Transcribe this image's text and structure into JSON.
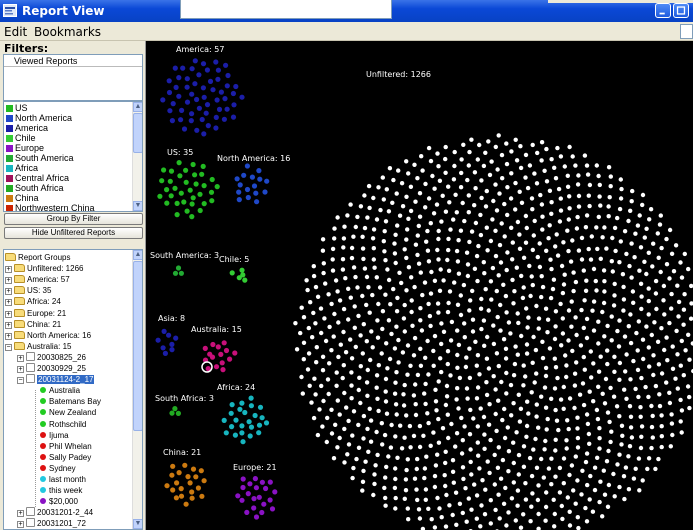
{
  "window": {
    "title": "Report View"
  },
  "menu": {
    "items": [
      "Edit",
      "Bookmarks"
    ]
  },
  "filters": {
    "heading": "Filters:",
    "viewed_reports_header": "Viewed Reports",
    "legend": [
      {
        "label": "US",
        "color": "#22bb22"
      },
      {
        "label": "North America",
        "color": "#1f48c8"
      },
      {
        "label": "America",
        "color": "#1b1ea8"
      },
      {
        "label": "Chile",
        "color": "#33cc33"
      },
      {
        "label": "Europe",
        "color": "#8a12c4"
      },
      {
        "label": "South America",
        "color": "#22aa33"
      },
      {
        "label": "Africa",
        "color": "#17b5bf"
      },
      {
        "label": "Central Africa",
        "color": "#a0105a"
      },
      {
        "label": "South Africa",
        "color": "#22aa22"
      },
      {
        "label": "China",
        "color": "#cc7a10"
      },
      {
        "label": "Northwestern China",
        "color": "#cc2200"
      }
    ],
    "buttons": {
      "group_by": "Group By Filter",
      "hide_unfiltered": "Hide Unfiltered Reports"
    }
  },
  "tree": {
    "root": "Report Groups",
    "groups": [
      "Unfiltered: 1266",
      "America: 57",
      "US: 35",
      "Africa: 24",
      "Europe: 21",
      "China: 21",
      "North America: 16",
      "Australia: 15"
    ],
    "australia_children": [
      "20030825_26",
      "20030929_25",
      "20031124-2_17"
    ],
    "selected_children": [
      {
        "label": "Australia",
        "color": "#22cc22"
      },
      {
        "label": "Batemans Bay",
        "color": "#22cc22"
      },
      {
        "label": "New Zealand",
        "color": "#22cc22"
      },
      {
        "label": "Rothschild",
        "color": "#22cc22"
      },
      {
        "label": "Ijuma",
        "color": "#dd1111"
      },
      {
        "label": "Phil Whelan",
        "color": "#dd1111"
      },
      {
        "label": "Sally Padey",
        "color": "#dd1111"
      },
      {
        "label": "Sydney",
        "color": "#dd1111"
      },
      {
        "label": "last month",
        "color": "#22c8e0"
      },
      {
        "label": "this week",
        "color": "#22c8e0"
      },
      {
        "label": "$20,000",
        "color": "#8a12c4"
      }
    ],
    "more_children": [
      "20031201-2_44",
      "20031201_72"
    ]
  },
  "canvas": {
    "clusters": [
      {
        "label": "America: 57",
        "count": 57,
        "color": "#1b1ea8"
      },
      {
        "label": "US: 35",
        "count": 35,
        "color": "#22bb22"
      },
      {
        "label": "North America: 16",
        "count": 16,
        "color": "#1f48c8"
      },
      {
        "label": "South America: 3",
        "count": 3,
        "color": "#22aa33"
      },
      {
        "label": "Chile: 5",
        "count": 5,
        "color": "#33cc33"
      },
      {
        "label": "Asia: 8",
        "count": 8,
        "color": "#1b1ea8"
      },
      {
        "label": "Australia: 15",
        "count": 15,
        "color": "#c8107a"
      },
      {
        "label": "South Africa: 3",
        "count": 3,
        "color": "#22aa22"
      },
      {
        "label": "Africa: 24",
        "count": 24,
        "color": "#17b5bf"
      },
      {
        "label": "China: 21",
        "count": 21,
        "color": "#cc7a10"
      },
      {
        "label": "Europe: 21",
        "count": 21,
        "color": "#8a12c4"
      },
      {
        "label": "Unfiltered: 1266",
        "count": 1266,
        "color": "#ffffff"
      }
    ]
  }
}
